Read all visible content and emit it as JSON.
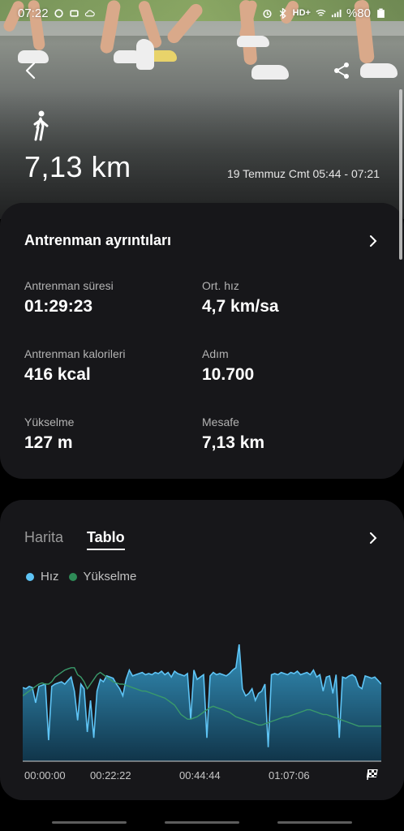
{
  "status_bar": {
    "time": "07:22",
    "network": "HD+",
    "battery": "%80"
  },
  "hero": {
    "activity_icon": "walking-person-icon",
    "distance": "7,13 km",
    "datetime": "19 Temmuz Cmt 05:44 - 07:21"
  },
  "details": {
    "title": "Antrenman ayrıntıları",
    "stats": [
      {
        "label": "Antrenman süresi",
        "value": "01:29:23"
      },
      {
        "label": "Ort. hız",
        "value": "4,7 km/sa"
      },
      {
        "label": "Antrenman kalorileri",
        "value": "416 kcal"
      },
      {
        "label": "Adım",
        "value": "10.700"
      },
      {
        "label": "Yükselme",
        "value": "127 m"
      },
      {
        "label": "Mesafe",
        "value": "7,13 km"
      }
    ]
  },
  "chart_card": {
    "tabs": [
      {
        "label": "Harita",
        "active": false
      },
      {
        "label": "Tablo",
        "active": true
      }
    ],
    "legend": [
      {
        "name": "Hız",
        "color": "#5ec4f5"
      },
      {
        "name": "Yükselme",
        "color": "#2e8b57"
      }
    ],
    "x_labels": [
      "00:00:00",
      "00:22:22",
      "00:44:44",
      "01:07:06"
    ]
  },
  "chart_data": {
    "type": "area",
    "x_ticks": [
      "00:00:00",
      "00:22:22",
      "00:44:44",
      "01:07:06"
    ],
    "series": [
      {
        "name": "Hız",
        "color": "#5ec4f5",
        "values": [
          0.63,
          0.62,
          0.64,
          0.63,
          0.5,
          0.64,
          0.65,
          0.66,
          0.18,
          0.64,
          0.66,
          0.67,
          0.68,
          0.66,
          0.69,
          0.72,
          0.6,
          0.35,
          0.66,
          0.62,
          0.25,
          0.52,
          0.2,
          0.6,
          0.7,
          0.68,
          0.73,
          0.72,
          0.71,
          0.66,
          0.62,
          0.56,
          0.7,
          0.78,
          0.73,
          0.74,
          0.75,
          0.76,
          0.74,
          0.75,
          0.74,
          0.76,
          0.75,
          0.77,
          0.74,
          0.76,
          0.72,
          0.77,
          0.75,
          0.74,
          0.73,
          0.75,
          0.36,
          0.78,
          0.7,
          0.72,
          0.74,
          0.2,
          0.73,
          0.76,
          0.74,
          0.75,
          0.74,
          0.73,
          0.75,
          0.78,
          0.8,
          1.0,
          0.62,
          0.56,
          0.58,
          0.62,
          0.52,
          0.58,
          0.6,
          0.66,
          0.12,
          0.74,
          0.75,
          0.74,
          0.76,
          0.75,
          0.74,
          0.76,
          0.75,
          0.77,
          0.74,
          0.75,
          0.76,
          0.74,
          0.78,
          0.72,
          0.74,
          0.6,
          0.72,
          0.73,
          0.58,
          0.74,
          0.2,
          0.72,
          0.71,
          0.73,
          0.74,
          0.72,
          0.64,
          0.62,
          0.73,
          0.72,
          0.71,
          0.72,
          0.69,
          0.66
        ]
      },
      {
        "name": "Yükselme",
        "color": "#2e8b57",
        "values": [
          0.56,
          0.58,
          0.6,
          0.62,
          0.64,
          0.66,
          0.67,
          0.66,
          0.66,
          0.68,
          0.72,
          0.74,
          0.76,
          0.78,
          0.79,
          0.8,
          0.8,
          0.74,
          0.72,
          0.68,
          0.62,
          0.66,
          0.7,
          0.74,
          0.76,
          0.74,
          0.72,
          0.7,
          0.68,
          0.67,
          0.66,
          0.66,
          0.65,
          0.64,
          0.63,
          0.62,
          0.61,
          0.6,
          0.6,
          0.59,
          0.58,
          0.57,
          0.56,
          0.55,
          0.54,
          0.52,
          0.5,
          0.48,
          0.44,
          0.4,
          0.38,
          0.36,
          0.36,
          0.37,
          0.38,
          0.4,
          0.42,
          0.44,
          0.46,
          0.47,
          0.46,
          0.45,
          0.44,
          0.43,
          0.42,
          0.4,
          0.38,
          0.37,
          0.36,
          0.35,
          0.34,
          0.33,
          0.32,
          0.31,
          0.31,
          0.32,
          0.33,
          0.34,
          0.35,
          0.36,
          0.37,
          0.38,
          0.38,
          0.39,
          0.4,
          0.41,
          0.42,
          0.43,
          0.44,
          0.44,
          0.43,
          0.42,
          0.41,
          0.4,
          0.4,
          0.39,
          0.38,
          0.37,
          0.36,
          0.35,
          0.34,
          0.33,
          0.32,
          0.31,
          0.3,
          0.3,
          0.3,
          0.3,
          0.3,
          0.3,
          0.3,
          0.3
        ]
      }
    ]
  }
}
